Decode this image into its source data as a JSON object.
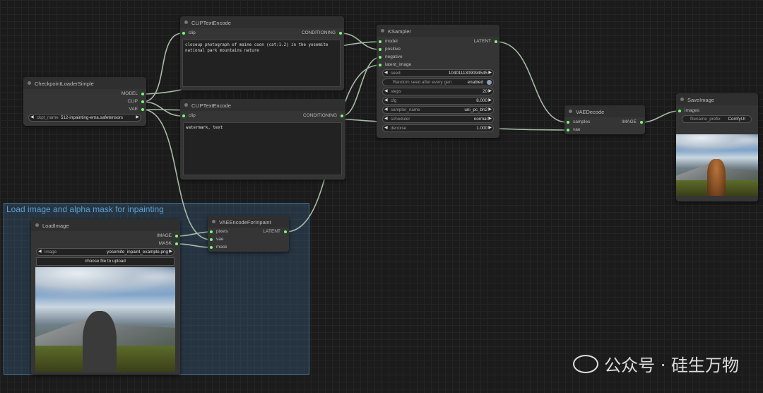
{
  "group": {
    "title": "Load image and alpha mask for inpainting"
  },
  "clip_encode_positive": {
    "title": "CLIPTextEncode",
    "input": "clip",
    "output": "CONDITIONING",
    "text": "closeup photograph of maine coon (cat:1.2) in the yosemite\nnational park mountains nature"
  },
  "clip_encode_negative": {
    "title": "CLIPTextEncode",
    "input": "clip",
    "output": "CONDITIONING",
    "text": "watermark, text"
  },
  "checkpoint_loader": {
    "title": "CheckpointLoaderSimple",
    "outputs": [
      "MODEL",
      "CLIP",
      "VAE"
    ],
    "ckpt_label": "ckpt_name",
    "ckpt_value": "512-inpainting-ema.safetensors"
  },
  "ksampler": {
    "title": "KSampler",
    "inputs": [
      "model",
      "positive",
      "negative",
      "latent_image"
    ],
    "output": "LATENT",
    "widgets": [
      {
        "label": "seed",
        "value": "1040111309094545"
      },
      {
        "label": "Random seed after every gen",
        "value": "enabled"
      },
      {
        "label": "steps",
        "value": "20"
      },
      {
        "label": "cfg",
        "value": "8.000"
      },
      {
        "label": "sampler_name",
        "value": "uni_pc_bh2"
      },
      {
        "label": "scheduler",
        "value": "normal"
      },
      {
        "label": "denoise",
        "value": "1.000"
      }
    ]
  },
  "vae_decode": {
    "title": "VAEDecode",
    "inputs": [
      "samples",
      "vae"
    ],
    "output": "IMAGE"
  },
  "save_image": {
    "title": "SaveImage",
    "input": "images",
    "prefix_label": "filename_prefix",
    "prefix_value": "ComfyUI"
  },
  "load_image": {
    "title": "LoadImage",
    "outputs": [
      "IMAGE",
      "MASK"
    ],
    "image_label": "image",
    "image_value": "yosemite_inpaint_example.png",
    "upload_label": "choose file to upload"
  },
  "vae_encode_inpaint": {
    "title": "VAEEncodeForInpaint",
    "inputs": [
      "pixels",
      "vae",
      "mask"
    ],
    "output": "LATENT"
  },
  "watermark": {
    "text": "公众号 · 硅生万物"
  },
  "colors": {
    "slot": "#77ff77",
    "wire": "#a8bba8",
    "group": "#5b9fcf"
  }
}
